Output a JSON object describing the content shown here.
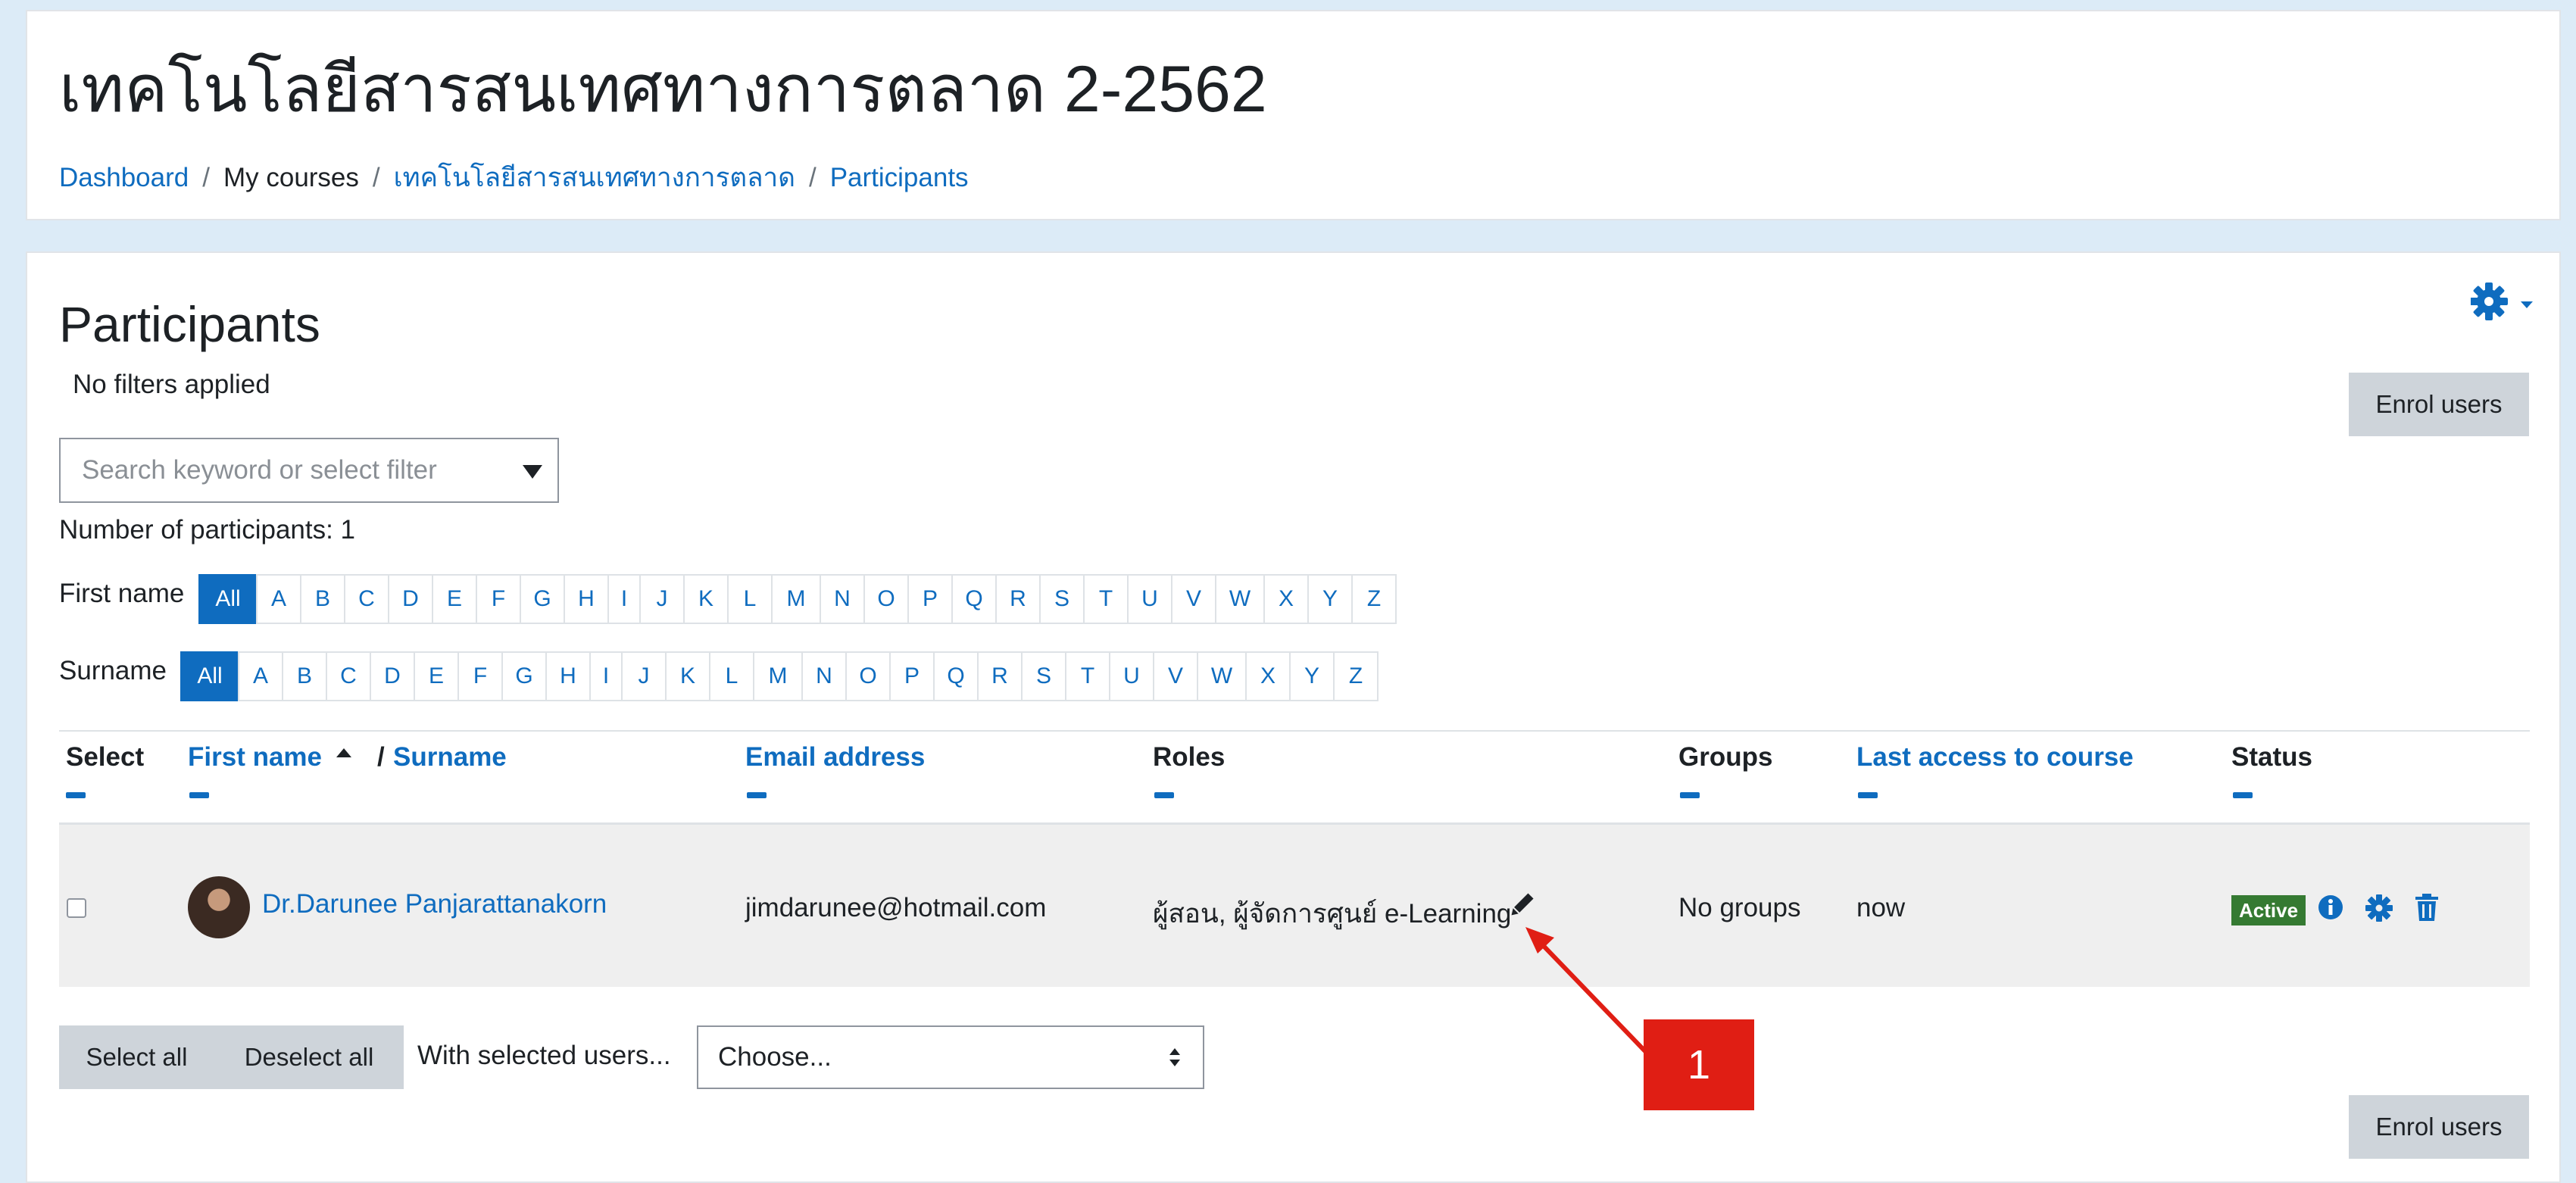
{
  "header": {
    "title": "เทคโนโลยีสารสนเทศทางการตลาด 2-2562",
    "breadcrumb": [
      "Dashboard",
      "My courses",
      "เทคโนโลยีสารสนเทศทางการตลาด",
      "Participants"
    ]
  },
  "main": {
    "title": "Participants",
    "filters_text": "No filters applied",
    "enrol_button": "Enrol users",
    "search_placeholder": "Search keyword or select filter",
    "participant_count": "Number of participants: 1",
    "first_name_label": "First name",
    "surname_label": "Surname",
    "letters": [
      "All",
      "A",
      "B",
      "C",
      "D",
      "E",
      "F",
      "G",
      "H",
      "I",
      "J",
      "K",
      "L",
      "M",
      "N",
      "O",
      "P",
      "Q",
      "R",
      "S",
      "T",
      "U",
      "V",
      "W",
      "X",
      "Y",
      "Z"
    ],
    "table": {
      "headers": {
        "select": "Select",
        "first_name": "First name",
        "surname_sep": "/",
        "surname": "Surname",
        "email": "Email address",
        "roles": "Roles",
        "groups": "Groups",
        "last_access": "Last access to course",
        "status": "Status"
      },
      "row": {
        "name": "Dr.Darunee Panjarattanakorn",
        "email": "jimdarunee@hotmail.com",
        "roles": "ผู้สอน, ผู้จัดการศูนย์ e-Learning",
        "groups": "No groups",
        "last_access": "now",
        "status": "Active"
      }
    },
    "bulk": {
      "select_all": "Select all",
      "deselect_all": "Deselect all",
      "with_selected": "With selected users...",
      "choose": "Choose..."
    }
  },
  "annotation": {
    "callout_number": "1",
    "color": "#e01e14"
  },
  "colors": {
    "link": "#0f6cbf",
    "active_badge": "#357a32",
    "button_gray": "#ced4da"
  }
}
